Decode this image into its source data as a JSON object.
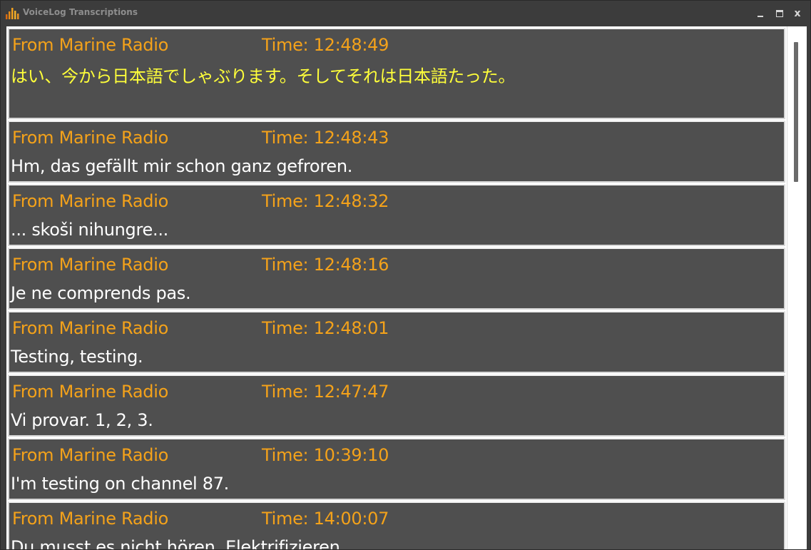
{
  "window": {
    "title": "VoiceLog Transcriptions",
    "controls": {
      "minimize": "minimize",
      "maximize": "maximize",
      "close": "x"
    }
  },
  "colors": {
    "header_text": "#f4a21a",
    "message_text": "#ffffff",
    "highlight_text": "#ffff3a",
    "entry_bg": "#4f4f4f"
  },
  "entries": [
    {
      "from": "From Marine Radio",
      "time": "Time: 12:48:49",
      "message": "はい、今から日本語でしゃぶります。そしてそれは日本語たった。",
      "highlight": true
    },
    {
      "from": "From Marine Radio",
      "time": "Time: 12:48:43",
      "message": "Hm, das gefällt mir schon ganz gefroren."
    },
    {
      "from": "From Marine Radio",
      "time": "Time: 12:48:32",
      "message": "... skoši nihungre..."
    },
    {
      "from": "From Marine Radio",
      "time": "Time: 12:48:16",
      "message": "Je ne comprends pas."
    },
    {
      "from": "From Marine Radio",
      "time": "Time: 12:48:01",
      "message": "Testing, testing."
    },
    {
      "from": "From Marine Radio",
      "time": "Time: 12:47:47",
      "message": "Vi provar. 1, 2, 3."
    },
    {
      "from": "From Marine Radio",
      "time": "Time: 10:39:10",
      "message": "I'm testing on channel 87."
    },
    {
      "from": "From Marine Radio",
      "time": "Time: 14:00:07",
      "message": "Du musst es nicht hören. Elektrifizieren"
    }
  ]
}
